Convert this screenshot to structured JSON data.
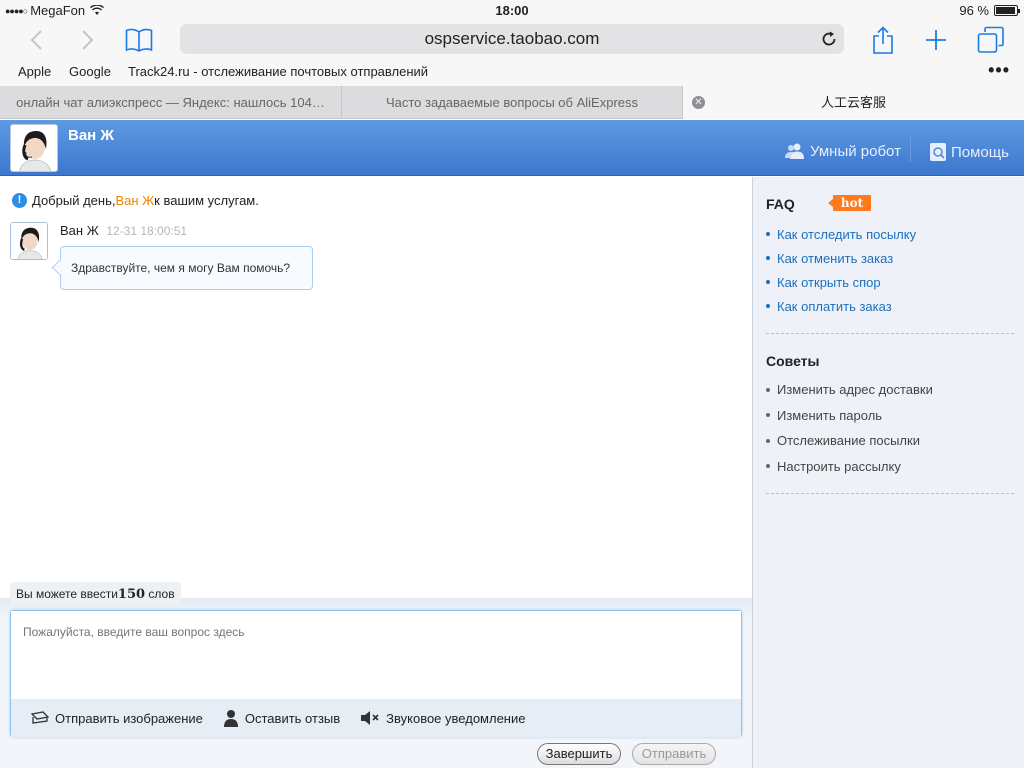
{
  "status_bar": {
    "signal": "●●●●○",
    "carrier": "MegaFon",
    "time": "18:00",
    "battery_text": "96 %",
    "battery_level": 0.96
  },
  "browser": {
    "url": "ospservice.taobao.com",
    "icons": {
      "back": "chevron-left-icon",
      "forward": "chevron-right-icon",
      "bookmarks": "book-icon",
      "reload": "reload-icon",
      "share": "share-icon",
      "new_tab": "plus-icon",
      "tabs": "tabs-icon"
    },
    "favorites": [
      "Apple",
      "Google",
      "Track24.ru - отслеживание почтовых отправлений"
    ],
    "more": "•••",
    "tabs": [
      {
        "title": "онлайн чат алиэкспресс — Яндекс: нашлось 104…"
      },
      {
        "title": "Часто задаваемые вопросы об AliExpress"
      },
      {
        "title": "人工云客服"
      }
    ]
  },
  "header": {
    "agent_name": "Ван Ж",
    "robot_label": "Умный робот",
    "help_label": "Помощь"
  },
  "chat": {
    "notice_prefix": "Добрый день, ",
    "notice_name": "Ван Ж",
    "notice_suffix": " к вашим услугам.",
    "message": {
      "sender": "Ван Ж",
      "time": "12-31 18:00:51",
      "text": "Здравствуйте, чем я могу Вам помочь?"
    }
  },
  "composer": {
    "counter_prefix": "Вы можете ввести",
    "counter_number": "150",
    "counter_suffix": " слов",
    "placeholder": "Пожалуйста, введите ваш вопрос здесь",
    "actions": {
      "send_image": "Отправить изображение",
      "feedback": "Оставить отзыв",
      "sound": "Звуковое уведомление"
    },
    "finish_label": "Завершить",
    "send_label": "Отправить"
  },
  "sidebar": {
    "faq_title": "FAQ",
    "hot_badge": "hot",
    "faq": [
      "Как отследить посылку",
      "Как отменить заказ",
      "Как открыть спор",
      "Как оплатить заказ"
    ],
    "tips_title": "Советы",
    "tips": [
      "Изменить адрес доставки",
      "Изменить пароль",
      "Отслеживание посылки",
      "Настроить рассылку"
    ]
  },
  "colors": {
    "header_blue": "#3d77cf",
    "link_blue": "#1b6fbf",
    "accent_orange": "#f08300",
    "hot_orange": "#ff7a1a",
    "ios_blue": "#1a7be3"
  }
}
